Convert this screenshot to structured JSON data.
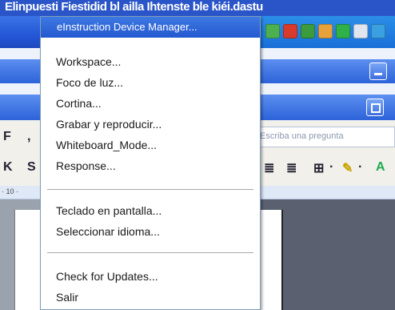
{
  "top_strip_text": "Elinpuesti Fiestidid bl ailla Ihtenste ble kiéi.dastu",
  "menu": {
    "header": "eInstruction Device Manager...",
    "groups": [
      [
        "Workspace...",
        "Foco de luz...",
        "Cortina...",
        "Grabar y reproducir...",
        "Whiteboard_Mode...",
        "Response..."
      ],
      [
        "Teclado en pantalla...",
        "Seleccionar idioma..."
      ],
      [
        "Check for Updates...",
        "Salir"
      ]
    ]
  },
  "word": {
    "ask_placeholder": "Escriba una pregunta",
    "ruler_text": "· 10 ·"
  },
  "colors": {
    "menu_header": "#2458cf",
    "taskbar": "#2457d6",
    "menu_border": "#7f9db9"
  }
}
